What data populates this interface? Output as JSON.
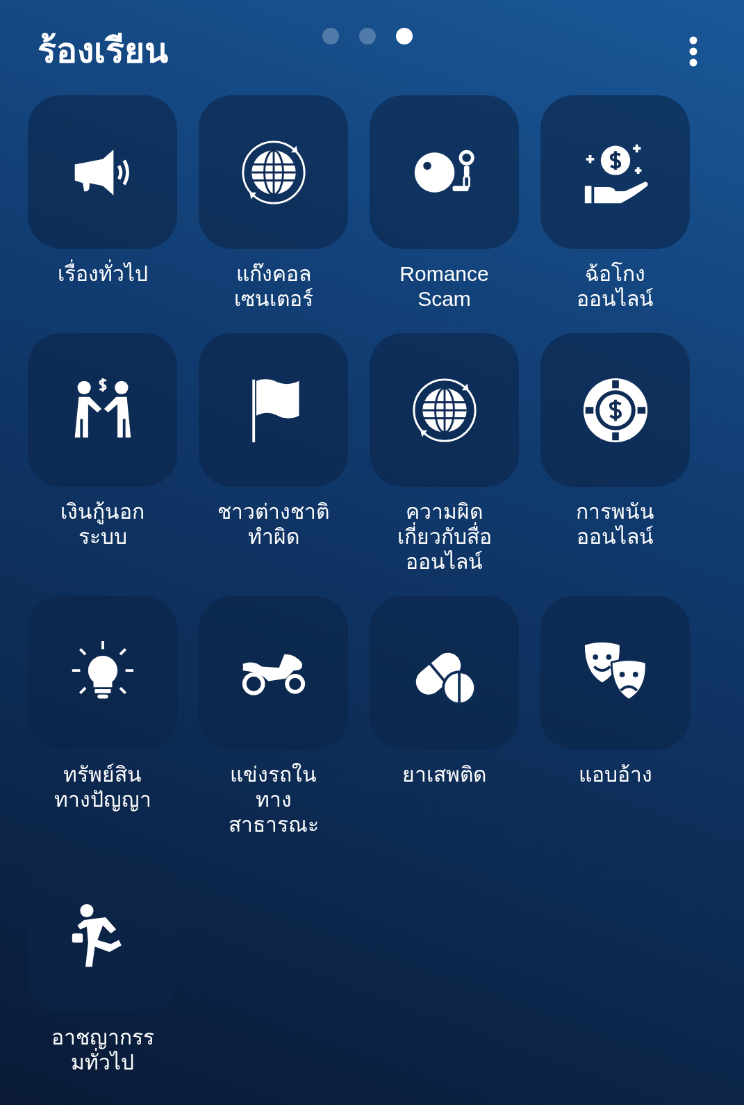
{
  "header": {
    "title": "ร้องเรียน"
  },
  "pager": [
    {
      "selected": false
    },
    {
      "selected": false
    },
    {
      "selected": true
    }
  ],
  "categories": [
    {
      "label": "เรื่องทั่วไป"
    },
    {
      "label": "แก๊งคอล\nเซนเตอร์"
    },
    {
      "label": "Romance\nScam"
    },
    {
      "label": "ฉ้อโกง\nออนไลน์"
    },
    {
      "label": "เงินกู้นอก\nระบบ"
    },
    {
      "label": "ชาวต่างชาติ\nทำผิด"
    },
    {
      "label": "ความผิด\nเกี่ยวกับสื่อ\nออนไลน์"
    },
    {
      "label": "การพนัน\nออนไลน์"
    },
    {
      "label": "ทรัพย์สิน\nทางปัญญา"
    },
    {
      "label": "แข่งรถใน\nทาง\nสาธารณะ"
    },
    {
      "label": "ยาเสพติด"
    },
    {
      "label": "แอบอ้าง"
    },
    {
      "label": "อาชญากรร\nมทั่วไป"
    }
  ]
}
